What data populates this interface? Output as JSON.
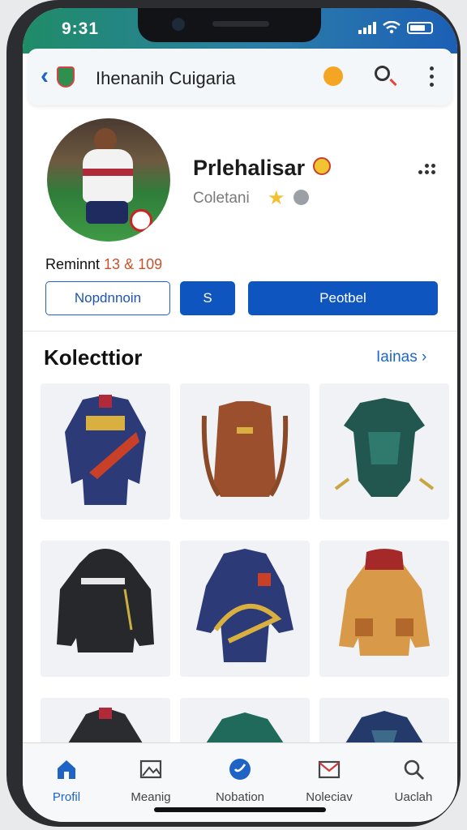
{
  "status_bar": {
    "time": "9:31"
  },
  "app_bar": {
    "title": "Ihenanih Cuigaria"
  },
  "profile": {
    "name": "Prlehalisar",
    "subtitle": "Coletani",
    "stats_label": "Reminnt",
    "stats_values": "13 & 109"
  },
  "actions": {
    "outline_button": "Nopdnnoin",
    "small_button": "S",
    "primary_button": "Peotbel"
  },
  "collection": {
    "title": "Kolecttior",
    "link": "Iainas"
  },
  "tabs": [
    {
      "label": "Profil",
      "icon": "home-icon",
      "active": true
    },
    {
      "label": "Meanig",
      "icon": "image-icon",
      "active": false
    },
    {
      "label": "Nobation",
      "icon": "bird-icon",
      "active": false
    },
    {
      "label": "Noleciav",
      "icon": "mail-icon",
      "active": false
    },
    {
      "label": "Uaclah",
      "icon": "search-icon",
      "active": false
    }
  ],
  "colors": {
    "accent": "#0f55c0",
    "link": "#1e66c8",
    "notification_dot": "#f5a524"
  }
}
